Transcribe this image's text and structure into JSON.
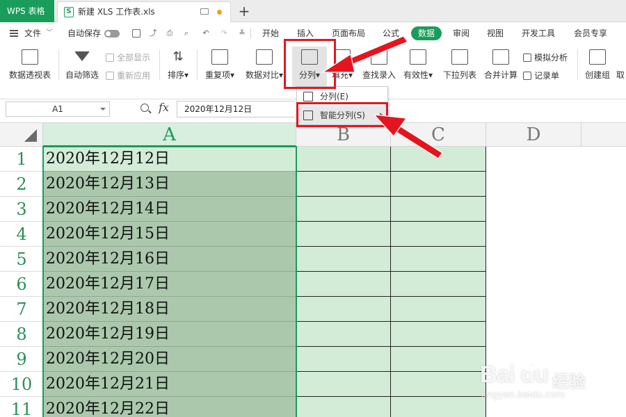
{
  "app": {
    "name": "WPS 表格"
  },
  "document": {
    "title": "新建 XLS 工作表.xls"
  },
  "menu": {
    "file": "文件",
    "autosave": "自动保存",
    "tabs": [
      "开始",
      "插入",
      "页面布局",
      "公式",
      "数据",
      "审阅",
      "视图",
      "开发工具",
      "会员专享"
    ],
    "active_tab": "数据"
  },
  "ribbon": {
    "pivot": "数据透视表",
    "autofilter": "自动筛选",
    "show_all": "全部显示",
    "reapply": "重新应用",
    "sort": "排序",
    "duplicates": "重复项",
    "compare": "数据对比",
    "split": "分列",
    "fill": "填充",
    "lookup_entry": "查找录入",
    "validity": "有效性",
    "dropdown_list": "下拉列表",
    "consolidate": "合并计算",
    "simulation": "模拟分析",
    "record_form": "记录单",
    "create_group": "创建组",
    "cancel_short": "取"
  },
  "split_menu": {
    "items": [
      "分列(E)",
      "智能分列(S)"
    ]
  },
  "formula_bar": {
    "name_box": "A1",
    "fx": "fx",
    "value": "2020年12月12日"
  },
  "sheet": {
    "columns": [
      "A",
      "B",
      "C",
      "D"
    ],
    "rows": [
      {
        "n": "1",
        "a": "2020年12月12日"
      },
      {
        "n": "2",
        "a": "2020年12月13日"
      },
      {
        "n": "3",
        "a": "2020年12月14日"
      },
      {
        "n": "4",
        "a": "2020年12月15日"
      },
      {
        "n": "5",
        "a": "2020年12月16日"
      },
      {
        "n": "6",
        "a": "2020年12月17日"
      },
      {
        "n": "7",
        "a": "2020年12月18日"
      },
      {
        "n": "8",
        "a": "2020年12月19日"
      },
      {
        "n": "9",
        "a": "2020年12月20日"
      },
      {
        "n": "10",
        "a": "2020年12月21日"
      },
      {
        "n": "11",
        "a": "2020年12月22日"
      }
    ]
  },
  "watermark": {
    "logo": "Bai  du",
    "text": "经验",
    "url": "jingyan.baidu.com"
  },
  "colors": {
    "brand": "#1a9d5b",
    "highlight": "#e5151f",
    "selected_fill": "#abc8ad",
    "column_fill": "#d3ecd8"
  }
}
